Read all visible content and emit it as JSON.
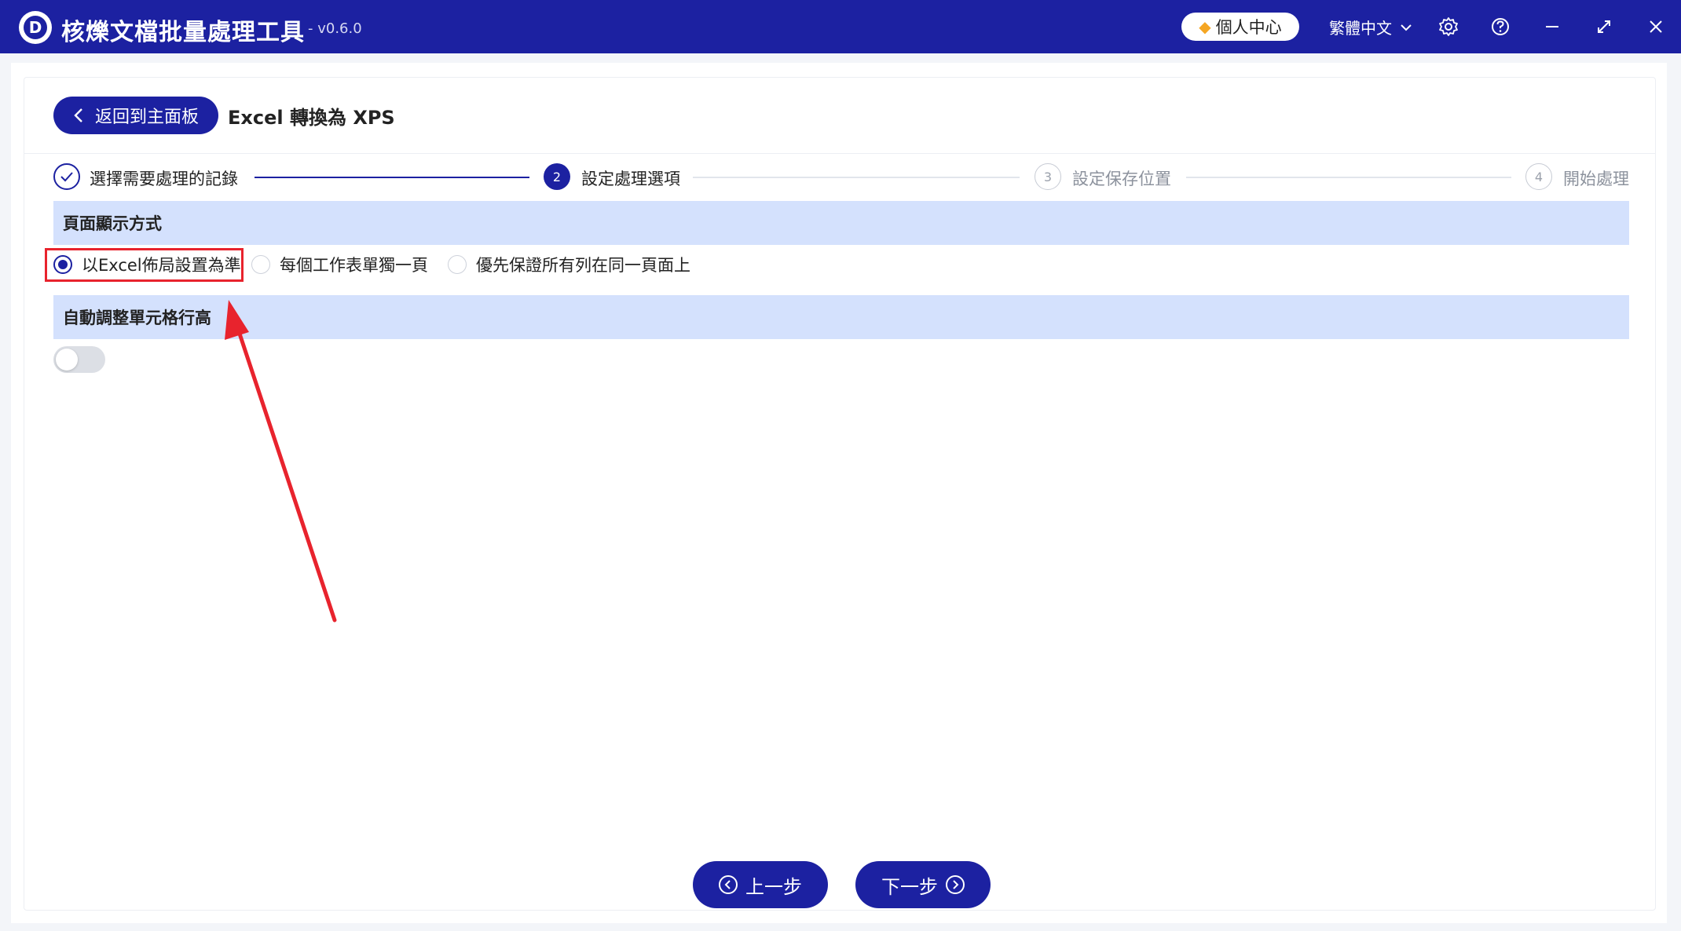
{
  "app": {
    "title": "核爍文檔批量處理工具",
    "version": "- v0.6.0",
    "logo_letter": "D",
    "user_center_label": "個人中心",
    "language": "繁體中文"
  },
  "header": {
    "back_label": "返回到主面板",
    "page_title": "Excel 轉換為 XPS"
  },
  "steps": [
    {
      "number": "✓",
      "label": "選擇需要處理的記錄",
      "state": "done"
    },
    {
      "number": "2",
      "label": "設定處理選項",
      "state": "active"
    },
    {
      "number": "3",
      "label": "設定保存位置",
      "state": "pending"
    },
    {
      "number": "4",
      "label": "開始處理",
      "state": "pending"
    }
  ],
  "sections": {
    "page_display": {
      "title": "頁面顯示方式",
      "options": [
        {
          "label": "以Excel佈局設置為準",
          "checked": true
        },
        {
          "label": "每個工作表單獨一頁",
          "checked": false
        },
        {
          "label": "優先保證所有列在同一頁面上",
          "checked": false
        }
      ]
    },
    "auto_row_height": {
      "title": "自動調整單元格行高",
      "enabled": false
    }
  },
  "nav": {
    "prev_label": "上一步",
    "next_label": "下一步"
  },
  "colors": {
    "brand": "#1c21a1",
    "section_bg": "#d4e1fd",
    "highlight": "#e8232d"
  }
}
